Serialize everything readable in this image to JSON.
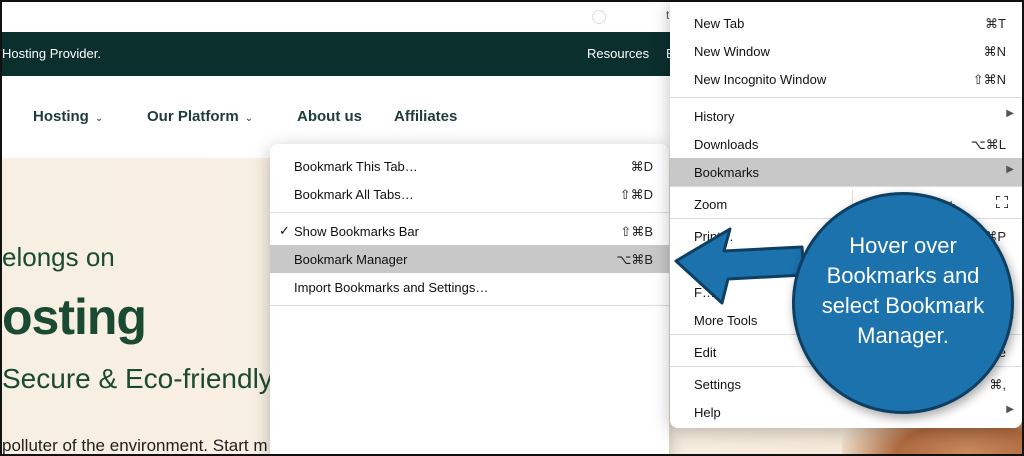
{
  "page": {
    "top_letter": "t",
    "banner_text": "Hosting Provider.",
    "banner_resources": "Resources",
    "banner_partial": "E",
    "nav": [
      {
        "label": "Hosting",
        "chevron": "⌄"
      },
      {
        "label": "Our Platform",
        "chevron": "⌄"
      },
      {
        "label": "About us"
      },
      {
        "label": "Affiliates"
      }
    ],
    "hero_line1": "elongs on",
    "hero_big": "osting",
    "hero_line2": "Secure & Eco-friendly",
    "hero_para": "polluter of the environment. Start m"
  },
  "bookmarks_menu": {
    "items": [
      {
        "label": "Bookmark This Tab…",
        "shortcut": "⌘D"
      },
      {
        "label": "Bookmark All Tabs…",
        "shortcut": "⇧⌘D"
      },
      {
        "label": "Show Bookmarks Bar",
        "shortcut": "⇧⌘B",
        "checked": "✓"
      },
      {
        "label": "Bookmark Manager",
        "shortcut": "⌥⌘B"
      },
      {
        "label": "Import Bookmarks and Settings…",
        "shortcut": ""
      }
    ]
  },
  "chrome_menu": {
    "items": [
      {
        "label": "New Tab",
        "shortcut": "⌘T"
      },
      {
        "label": "New Window",
        "shortcut": "⌘N"
      },
      {
        "label": "New Incognito Window",
        "shortcut": "⇧⌘N"
      },
      {
        "label": "History",
        "arrow": "▶"
      },
      {
        "label": "Downloads",
        "shortcut": "⌥⌘L"
      },
      {
        "label": "Bookmarks",
        "arrow": "▶"
      },
      {
        "label": "Zoom",
        "plus": "+"
      },
      {
        "label": "Print…",
        "shortcut": "⌘P"
      },
      {
        "label": "F…",
        "shortcut": "F"
      },
      {
        "label": "More Tools",
        "arrow": "▶"
      },
      {
        "label": "Edit",
        "shortcut": "aste"
      },
      {
        "label": "Settings",
        "shortcut": "⌘,"
      },
      {
        "label": "Help",
        "arrow": "▶"
      }
    ]
  },
  "callout": {
    "text": "Hover over Bookmarks and select Bookmark Manager.",
    "color": "#1b72ad"
  },
  "colors": {
    "banner": "#0b2f2d",
    "hero_green": "#1b4a33",
    "menu_highlight": "#c8c8c8"
  }
}
